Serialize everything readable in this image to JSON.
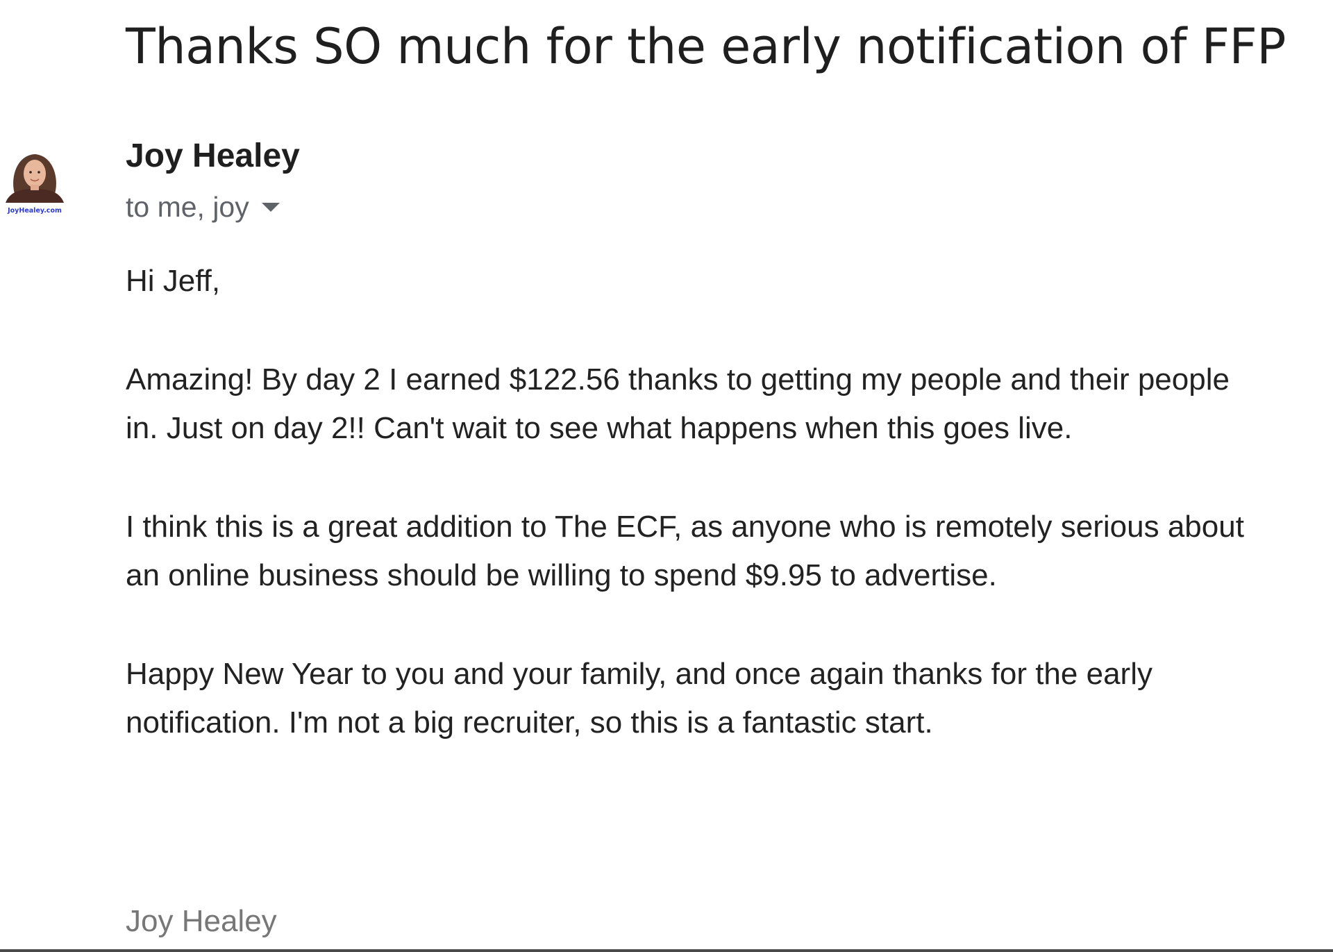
{
  "email": {
    "subject": "Thanks SO much for the early notification of FFP",
    "sender": {
      "name": "Joy Healey",
      "avatar_caption": "JoyHealey.com"
    },
    "recipients_text": "to me, joy",
    "body": {
      "greeting": "Hi Jeff,",
      "paragraphs": [
        "Amazing! By day 2 I earned $122.56 thanks to getting my people and their people in. Just on day 2!! Can't wait to see what happens when this goes live.",
        "I think this is a great addition to The ECF, as anyone who is remotely serious about an online business should be willing to spend $9.95 to advertise.",
        "Happy New Year to you and your family, and once again thanks for the early notification. I'm not a big recruiter, so this is a fantastic start."
      ],
      "signature": "Joy Healey"
    }
  },
  "icons": {
    "recipient_details": "chevron-down-icon",
    "avatar": "sender-avatar-photo"
  },
  "colors": {
    "subject_text": "#1f1f1f",
    "recipients_text": "#5f6368",
    "body_text": "#222222",
    "signature_text": "#777777",
    "avatar_caption": "#2b3bd1"
  }
}
